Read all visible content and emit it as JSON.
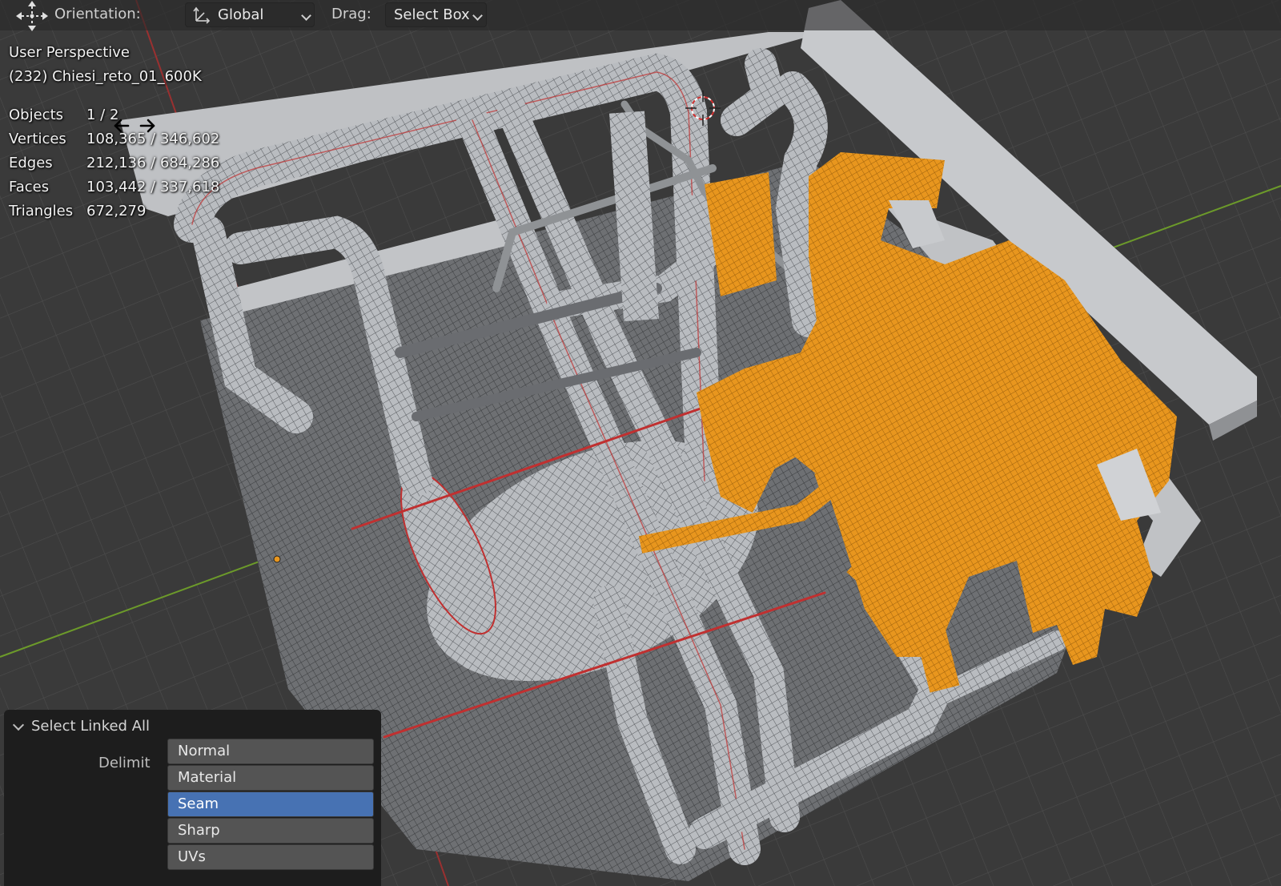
{
  "header": {
    "orientation_label": "Orientation:",
    "orientation_value": "Global",
    "drag_label": "Drag:",
    "drag_value": "Select Box"
  },
  "overlay": {
    "view_name": "User Perspective",
    "object_name": "(232) Chiesi_reto_01_600K",
    "stats": [
      {
        "label": "Objects",
        "value": "1 / 2"
      },
      {
        "label": "Vertices",
        "value": "108,365 / 346,602"
      },
      {
        "label": "Edges",
        "value": "212,136 / 684,286"
      },
      {
        "label": "Faces",
        "value": "103,442 / 337,618"
      },
      {
        "label": "Triangles",
        "value": "672,279"
      }
    ]
  },
  "operator_panel": {
    "title": "Select Linked All",
    "delimit_label": "Delimit",
    "options": [
      {
        "label": "Normal",
        "active": false
      },
      {
        "label": "Material",
        "active": false
      },
      {
        "label": "Seam",
        "active": true
      },
      {
        "label": "Sharp",
        "active": false
      },
      {
        "label": "UVs",
        "active": false
      }
    ]
  },
  "colors": {
    "selection": "#e8961e",
    "active_option": "#4772b3",
    "seam": "#c0282a"
  }
}
